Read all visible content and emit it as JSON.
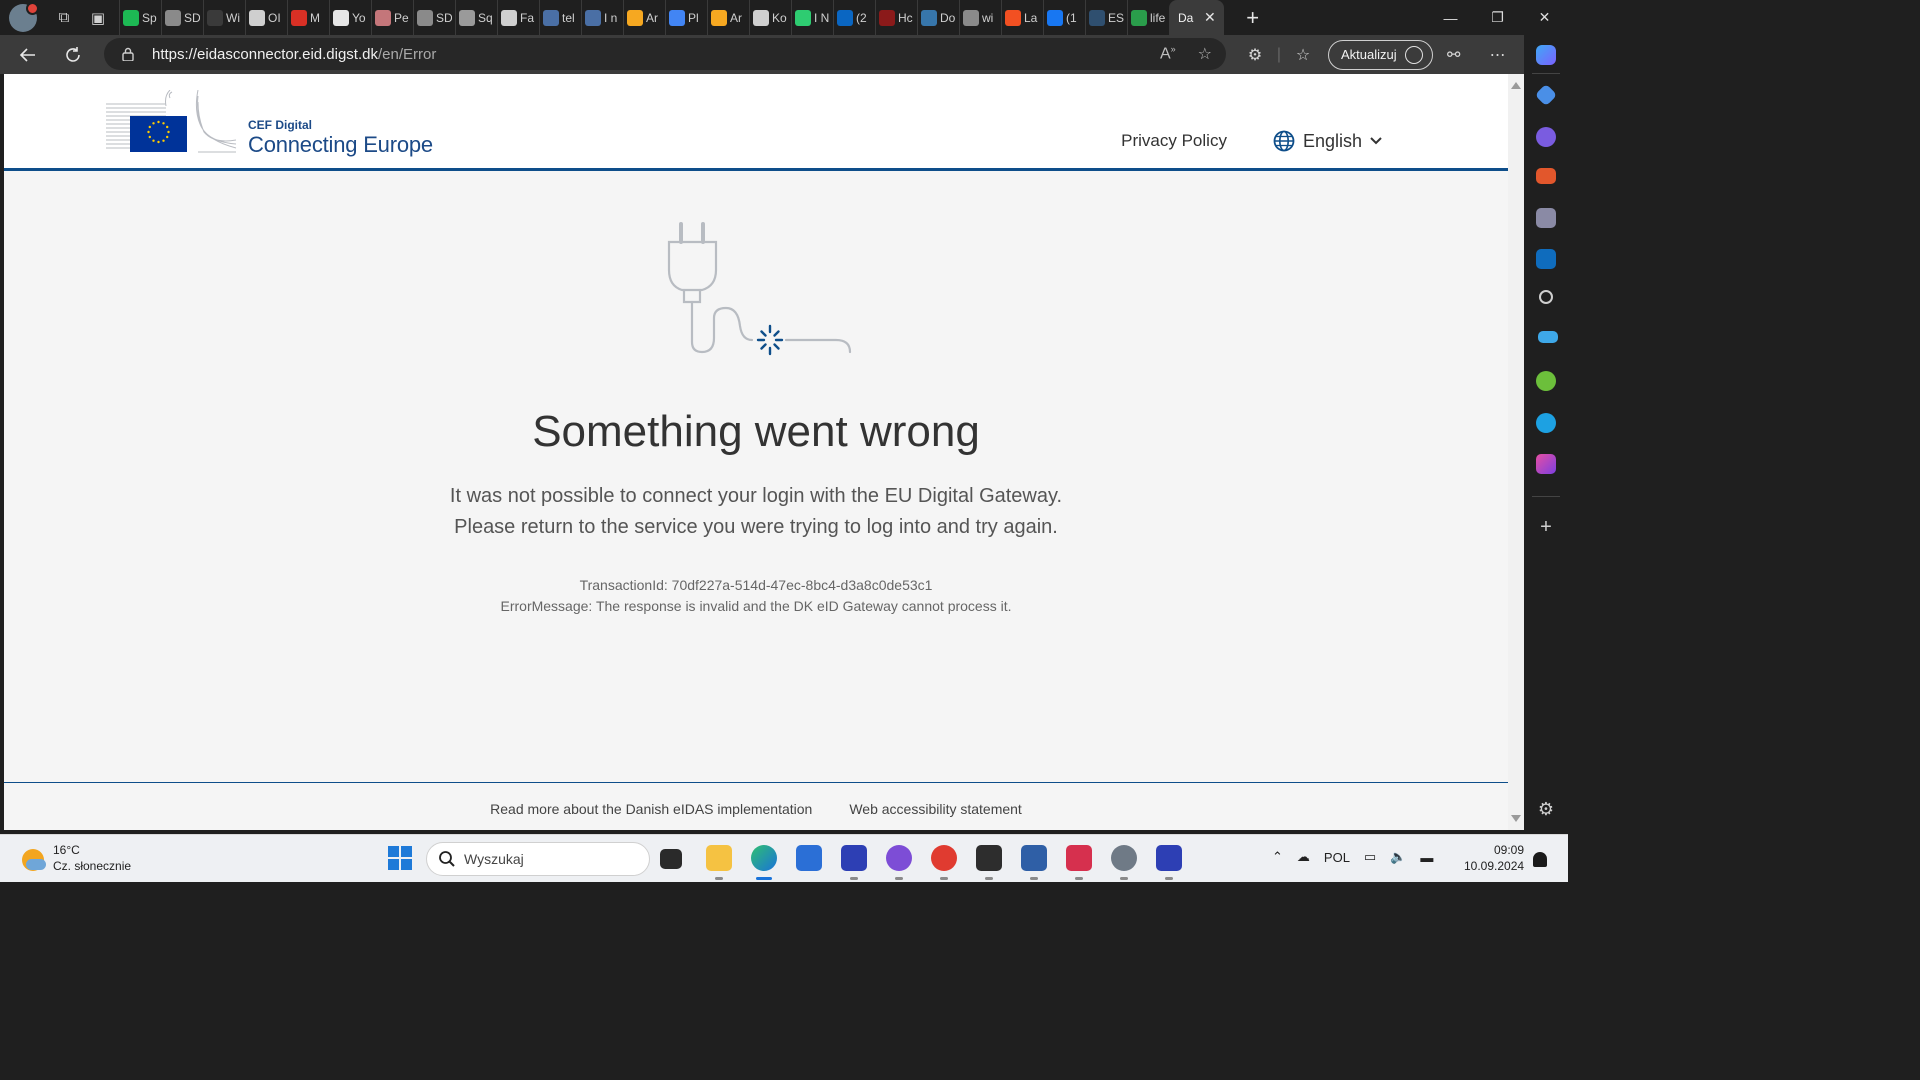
{
  "browser": {
    "tabs": [
      {
        "label": "Sp",
        "color": "#1db954"
      },
      {
        "label": "SD",
        "color": "#8a8a8a"
      },
      {
        "label": "Wi",
        "color": "#3a3a3a"
      },
      {
        "label": "OI",
        "color": "#cfcfcf"
      },
      {
        "label": "M",
        "color": "#d93025"
      },
      {
        "label": "Yo",
        "color": "#e6e6e6"
      },
      {
        "label": "Pe",
        "color": "#c4767a"
      },
      {
        "label": "SD",
        "color": "#8a8a8a"
      },
      {
        "label": "Sq",
        "color": "#9a9a9a"
      },
      {
        "label": "Fa",
        "color": "#cfcfcf"
      },
      {
        "label": "tel",
        "color": "#4a6fa5"
      },
      {
        "label": "I n",
        "color": "#4a6fa5"
      },
      {
        "label": "Ar",
        "color": "#f6a821"
      },
      {
        "label": "Pl",
        "color": "#4285f4"
      },
      {
        "label": "Ar",
        "color": "#f6a821"
      },
      {
        "label": "Ko",
        "color": "#cfcfcf"
      },
      {
        "label": "I N",
        "color": "#2ecc71"
      },
      {
        "label": "(2",
        "color": "#0a66c2"
      },
      {
        "label": "Hc",
        "color": "#8b1a1a"
      },
      {
        "label": "Do",
        "color": "#3776ab"
      },
      {
        "label": "wi",
        "color": "#8a8a8a"
      },
      {
        "label": "La",
        "color": "#f25022"
      },
      {
        "label": "(1",
        "color": "#1877f2"
      },
      {
        "label": "ES",
        "color": "#2f4f6f"
      },
      {
        "label": "life",
        "color": "#2a9d4b"
      }
    ],
    "active_tab": {
      "label": "Da",
      "close": "✕"
    },
    "new_tab": "+",
    "window_controls": {
      "minimize": "—",
      "restore": "❐",
      "close": "✕"
    },
    "url_host": "https://eidasconnector.eid.digst.dk",
    "url_path": "/en/Error",
    "update_button": "Aktualizuj"
  },
  "site": {
    "logo_small": "CEF Digital",
    "logo_big": "Connecting Europe",
    "privacy_link": "Privacy Policy",
    "language": "English"
  },
  "error": {
    "title": "Something went wrong",
    "line1": "It was not possible to connect your login with the EU Digital Gateway.",
    "line2": "Please return to the service you were trying to log into and try again.",
    "transaction": "TransactionId: 70df227a-514d-47ec-8bc4-d3a8c0de53c1",
    "message": "ErrorMessage: The response is invalid and the DK eID Gateway cannot process it."
  },
  "footer": {
    "link1": "Read more about the Danish eIDAS implementation",
    "link2": "Web accessibility statement"
  },
  "taskbar": {
    "temperature": "16°C",
    "weather": "Cz. słonecznie",
    "search_placeholder": "Wyszukaj",
    "language": "POL",
    "time": "09:09",
    "date": "10.09.2024"
  },
  "colors": {
    "accent": "#0e4e8a",
    "eu_blue": "#003399",
    "eu_star": "#ffcc00"
  }
}
